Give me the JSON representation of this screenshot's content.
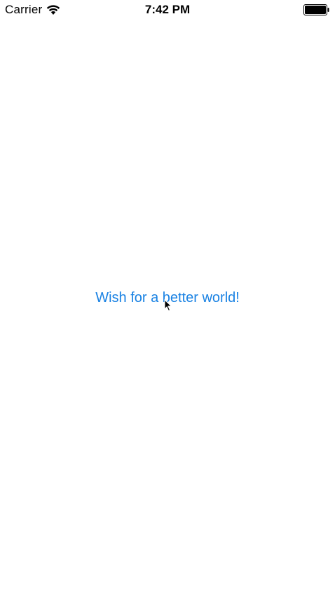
{
  "status_bar": {
    "carrier": "Carrier",
    "time": "7:42 PM",
    "wifi_icon": "wifi-icon",
    "battery_icon": "battery-icon"
  },
  "main": {
    "wish_button_label": "Wish for a better world!"
  },
  "colors": {
    "accent": "#1a82e3",
    "background": "#ffffff",
    "status_text": "#000000"
  }
}
